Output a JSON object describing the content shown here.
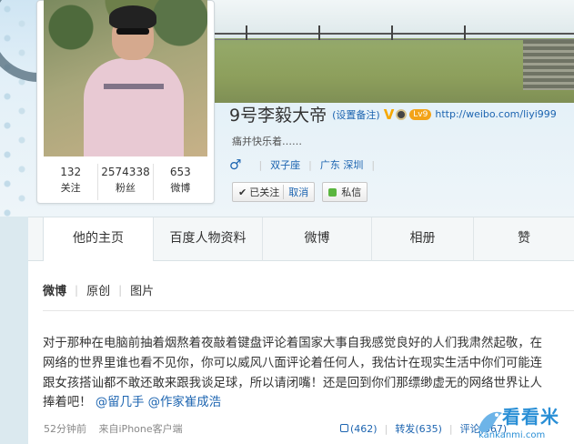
{
  "profile": {
    "name": "9号李毅大帝",
    "remark_link": "(设置备注)",
    "verified_badge": "V",
    "level": "Lv9",
    "url": "http://weibo.com/liyi999",
    "bio": "痛并快乐着……",
    "gender_symbol": "♂",
    "zodiac": "双子座",
    "location": "广东 深圳",
    "stats": [
      {
        "value": "132",
        "label": "关注"
      },
      {
        "value": "2574338",
        "label": "粉丝"
      },
      {
        "value": "653",
        "label": "微博"
      }
    ],
    "follow_button": {
      "check": "✔",
      "label": "已关注",
      "cancel": "取消"
    },
    "message_button": "私信"
  },
  "tabs": [
    "他的主页",
    "百度人物资料",
    "微博",
    "相册",
    "赞"
  ],
  "subtabs": [
    "微博",
    "原创",
    "图片"
  ],
  "post": {
    "text": "对于那种在电脑前抽着烟熬着夜敲着键盘评论着国家大事自我感觉良好的人们我肃然起敬，在网络的世界里谁也看不见你，你可以威风八面评论着任何人，我估计在现实生活中你们可能连跟女孩搭讪都不敢还敢来跟我谈足球，所以请闭嘴！还是回到你们那缥缈虚无的网络世界让人捧着吧！",
    "mention1": "@留几手",
    "mention2": "@作家崔成浩",
    "time": "52分钟前",
    "source": "来自iPhone客户端",
    "likes": "(462)",
    "repost_label": "转发",
    "repost_count": "(635)",
    "comment_label": "评论(667)"
  },
  "watermark": {
    "text": "看看米",
    "url": "kankanmi.com"
  },
  "colors": {
    "link": "#1c64b0",
    "badge": "#f6a800",
    "watermark": "#2a8fd6"
  }
}
